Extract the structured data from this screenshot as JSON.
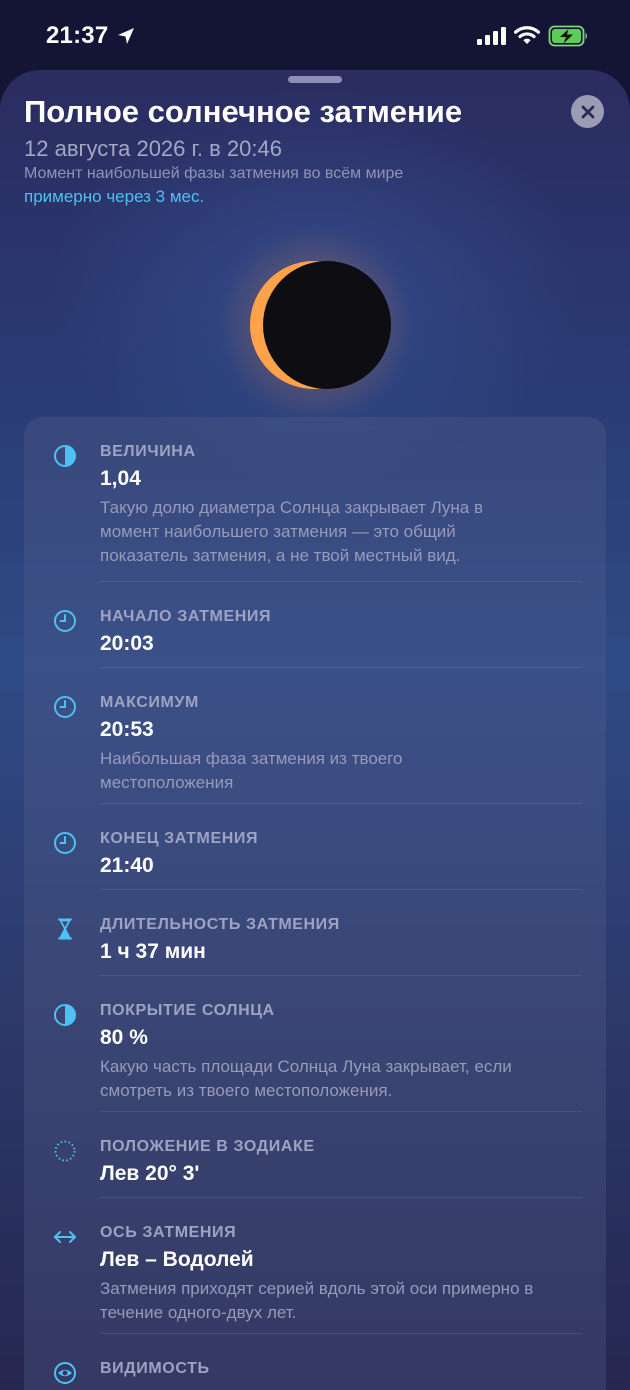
{
  "status_bar": {
    "time": "21:37",
    "icons": [
      "location-arrow-icon",
      "cellular-signal-icon",
      "wifi-icon",
      "battery-charging-icon"
    ]
  },
  "colors": {
    "accent": "#4fc0f2",
    "background": "#141535",
    "corona": "#ffa24a"
  },
  "header": {
    "title": "Полное солнечное затмение",
    "date": "12 августа 2026 г. в 20:46",
    "subtitle": "Момент наибольшей фазы затмения во всём мире",
    "relative_time": "примерно через 3 мес."
  },
  "details": [
    {
      "icon": "half-circle-icon",
      "label": "ВЕЛИЧИНА",
      "value": "1,04",
      "description": "Такую долю диаметра Солнца закрывает Луна в момент наибольшего затмения — это общий показатель затмения, а не твой местный вид."
    },
    {
      "icon": "clock-icon",
      "label": "НАЧАЛО ЗАТМЕНИЯ",
      "value": "20:03",
      "description": ""
    },
    {
      "icon": "clock-icon",
      "label": "МАКСИМУМ",
      "value": "20:53",
      "description": "Наибольшая фаза затмения из твоего местоположения"
    },
    {
      "icon": "clock-icon",
      "label": "КОНЕЦ ЗАТМЕНИЯ",
      "value": "21:40",
      "description": ""
    },
    {
      "icon": "hourglass-icon",
      "label": "ДЛИТЕЛЬНОСТЬ ЗАТМЕНИЯ",
      "value": "1 ч 37 мин",
      "description": ""
    },
    {
      "icon": "half-circle-icon",
      "label": "ПОКРЫТИЕ СОЛНЦА",
      "value": "80 %",
      "description": "Какую часть площади Солнца Луна закрывает, если смотреть из твоего местоположения."
    },
    {
      "icon": "dotted-circle-icon",
      "label": "ПОЛОЖЕНИЕ В ЗОДИАКЕ",
      "value": "Лев 20° 3'",
      "description": ""
    },
    {
      "icon": "double-arrow-icon",
      "label": "ОСЬ ЗАТМЕНИЯ",
      "value": "Лев – Водолей",
      "description": "Затмения приходят серией вдоль этой оси примерно в течение одного-двух лет."
    },
    {
      "icon": "eye-icon",
      "label": "ВИДИМОСТЬ",
      "value": "",
      "description": ""
    }
  ]
}
